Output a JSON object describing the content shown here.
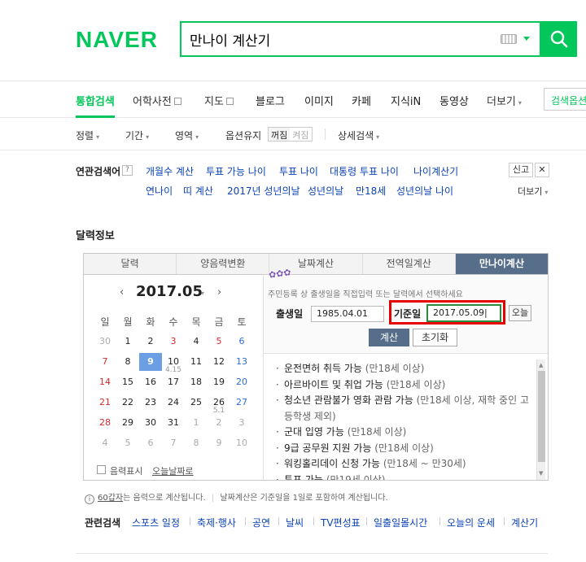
{
  "header": {
    "logo": "NAVER",
    "search_query": "만나이 계산기"
  },
  "tabs": [
    {
      "label": "통합검색"
    },
    {
      "label": "어학사전"
    },
    {
      "label": "지도"
    },
    {
      "label": "블로그"
    },
    {
      "label": "이미지"
    },
    {
      "label": "카페"
    },
    {
      "label": "지식iN"
    },
    {
      "label": "동영상"
    },
    {
      "label": "더보기"
    }
  ],
  "search_options_label": "검색옵션",
  "filters": {
    "sort": "정렬",
    "period": "기간",
    "area": "영역",
    "option_keep": "옵션유지",
    "toggle_on": "꺼짐",
    "toggle_off": "켜짐",
    "detail": "상세검색"
  },
  "related": {
    "title": "연관검색어",
    "help": "?",
    "links": [
      "개월수 계산",
      "투표 가능 나이",
      "투표 나이",
      "대통령 투표 나이",
      "나이계산기",
      "연나이",
      "띠 계산",
      "2017년 성년의날",
      "성년의날",
      "만18세",
      "성년의날 나이"
    ],
    "report": "신고",
    "close": "✕",
    "more": "더보기"
  },
  "calendar_section": {
    "heading": "달력정보",
    "tabs": [
      "달력",
      "양음력변환",
      "날짜계산",
      "전역일계산",
      "만나이계산"
    ],
    "month_label": "2017.05",
    "weekdays": [
      "일",
      "월",
      "화",
      "수",
      "목",
      "금",
      "토"
    ],
    "weeks": [
      [
        "30",
        "1",
        "2",
        "3",
        "4",
        "5",
        "6"
      ],
      [
        "7",
        "8",
        "9",
        "10",
        "11",
        "12",
        "13"
      ],
      [
        "14",
        "15",
        "16",
        "17",
        "18",
        "19",
        "20"
      ],
      [
        "21",
        "22",
        "23",
        "24",
        "25",
        "26",
        "27"
      ],
      [
        "28",
        "29",
        "30",
        "31",
        "1",
        "2",
        "3"
      ],
      [
        "4",
        "5",
        "6",
        "7",
        "8",
        "9",
        "10"
      ]
    ],
    "selected_day": "9",
    "sub_labels": {
      "w1d3": "4.15",
      "w3d5": "5.1"
    },
    "lunar_label": "음력표시",
    "today_link": "오늘날짜로",
    "hint": "주민등록 상 출생일을 직접입력 또는 달력에서 선택하세요",
    "birth_label": "출생일",
    "birth_value": "1985.04.01",
    "base_label": "기준일",
    "base_value": "2017.05.09|",
    "today_btn": "오늘",
    "calc_btn": "계산",
    "reset_btn": "초기화",
    "results": [
      {
        "text": "운전면허 취득 가능",
        "note": "(만18세 이상)"
      },
      {
        "text": "아르바이트 및 취업 가능",
        "note": "(만18세 이상)"
      },
      {
        "text": "청소년 관람불가 영화 관람 가능",
        "note": "(만18세 이상, 재학 중인 고등학생 제외)"
      },
      {
        "text": "군대 입영 가능",
        "note": "(만18세 이상)"
      },
      {
        "text": "9급 공무원 지원 가능",
        "note": "(만18세 이상)"
      },
      {
        "text": "워킹홀리데이 신청 가능",
        "note": "(만18세 ~ 만30세)"
      },
      {
        "text": "투표 가능",
        "note": "(만19세 이상)"
      }
    ],
    "bottom_note_link": "60갑자",
    "bottom_note_1": "는 음력으로 계산됩니다.",
    "bottom_note_2": "날짜계산은 기준일을 1일로 포함하여 계산됩니다."
  },
  "related_search": {
    "title": "관련검색",
    "links": [
      "스포츠 일정",
      "축제·행사",
      "공연",
      "날씨",
      "TV편성표",
      "일출일몰시간",
      "오늘의 운세",
      "계산기"
    ]
  },
  "colors": {
    "brand": "#03c75a",
    "link": "#0c43b7",
    "active_tab": "#566e8a",
    "highlight": "#e60000"
  }
}
